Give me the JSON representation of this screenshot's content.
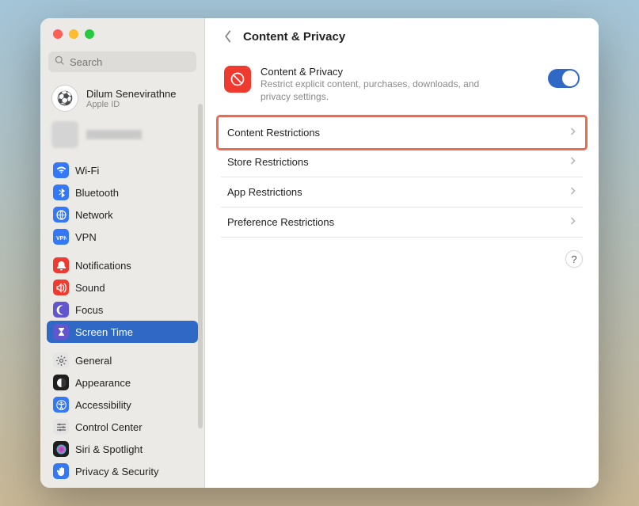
{
  "search": {
    "placeholder": "Search"
  },
  "account": {
    "name": "Dilum Senevirathne",
    "sub": "Apple ID"
  },
  "sidebar": {
    "groups": [
      {
        "items": [
          {
            "label": "Wi-Fi",
            "icon": "wifi",
            "color": "#3478f6"
          },
          {
            "label": "Bluetooth",
            "icon": "bluetooth",
            "color": "#3478f6"
          },
          {
            "label": "Network",
            "icon": "globe",
            "color": "#3478f6"
          },
          {
            "label": "VPN",
            "icon": "vpn",
            "color": "#3478f6"
          }
        ]
      },
      {
        "items": [
          {
            "label": "Notifications",
            "icon": "bell",
            "color": "#ee3a2f"
          },
          {
            "label": "Sound",
            "icon": "speaker",
            "color": "#ee3a2f"
          },
          {
            "label": "Focus",
            "icon": "moon",
            "color": "#6156ce"
          },
          {
            "label": "Screen Time",
            "icon": "hourglass",
            "color": "#6156ce",
            "selected": true
          }
        ]
      },
      {
        "items": [
          {
            "label": "General",
            "icon": "gear",
            "color": "#9c9c9c"
          },
          {
            "label": "Appearance",
            "icon": "appearance",
            "color": "#1f1f1f"
          },
          {
            "label": "Accessibility",
            "icon": "accessibility",
            "color": "#3478f6"
          },
          {
            "label": "Control Center",
            "icon": "controls",
            "color": "#9c9c9c"
          },
          {
            "label": "Siri & Spotlight",
            "icon": "siri",
            "color": "#1f1f1f"
          },
          {
            "label": "Privacy & Security",
            "icon": "hand",
            "color": "#3478f6"
          }
        ]
      }
    ]
  },
  "header": {
    "title": "Content & Privacy"
  },
  "main": {
    "hero": {
      "title": "Content & Privacy",
      "description": "Restrict explicit content, purchases, downloads, and privacy settings.",
      "toggle": true
    },
    "rows": [
      {
        "label": "Content Restrictions",
        "highlighted": true
      },
      {
        "label": "Store Restrictions"
      },
      {
        "label": "App Restrictions"
      },
      {
        "label": "Preference Restrictions"
      }
    ]
  },
  "help": "?"
}
